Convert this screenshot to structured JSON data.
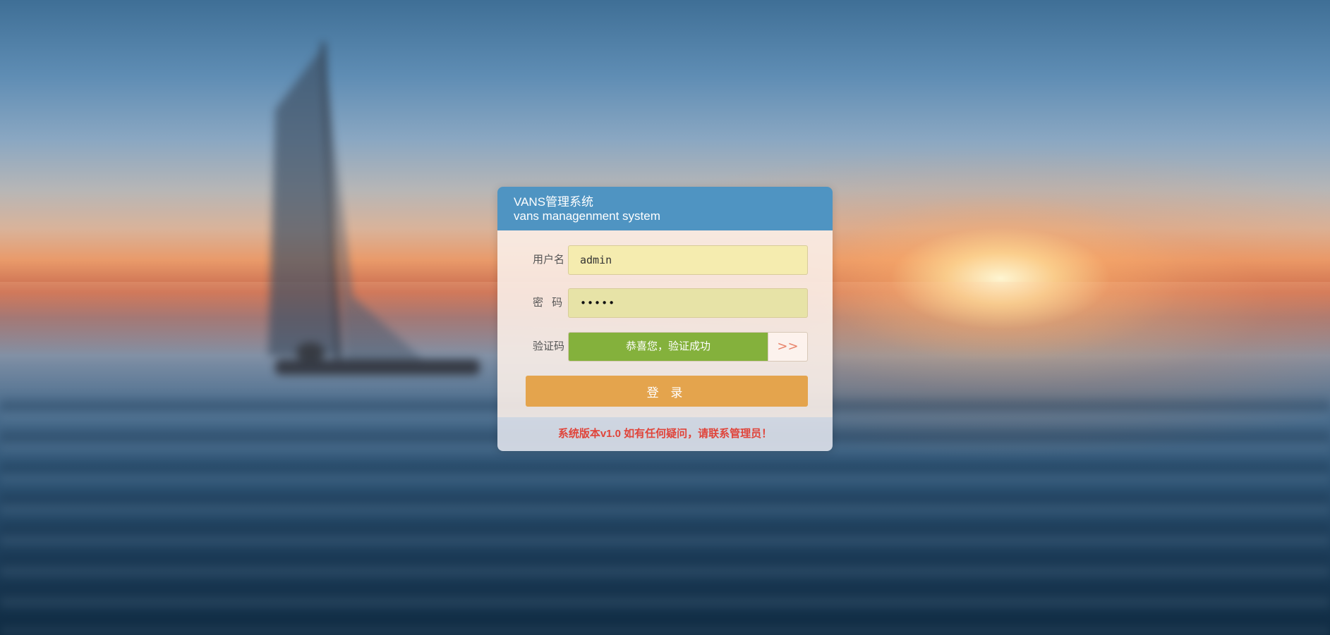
{
  "header": {
    "title": "VANS管理系统",
    "subtitle": "vans managenment system"
  },
  "form": {
    "username_label": "用户名",
    "username_value": "admin",
    "password_label": "密 码",
    "password_value": "•••••",
    "captcha_label": "验证码",
    "captcha_status": "恭喜您，验证成功",
    "captcha_handle": ">>",
    "login_button": "登 录"
  },
  "footer": {
    "version_text": "系统版本v1.0  如有任何疑问，请联系管理员！"
  },
  "colors": {
    "header_bg": "#4f94c2",
    "success_green": "#84b13c",
    "login_orange": "#e4a44d",
    "footer_text_red": "#e0443a"
  }
}
